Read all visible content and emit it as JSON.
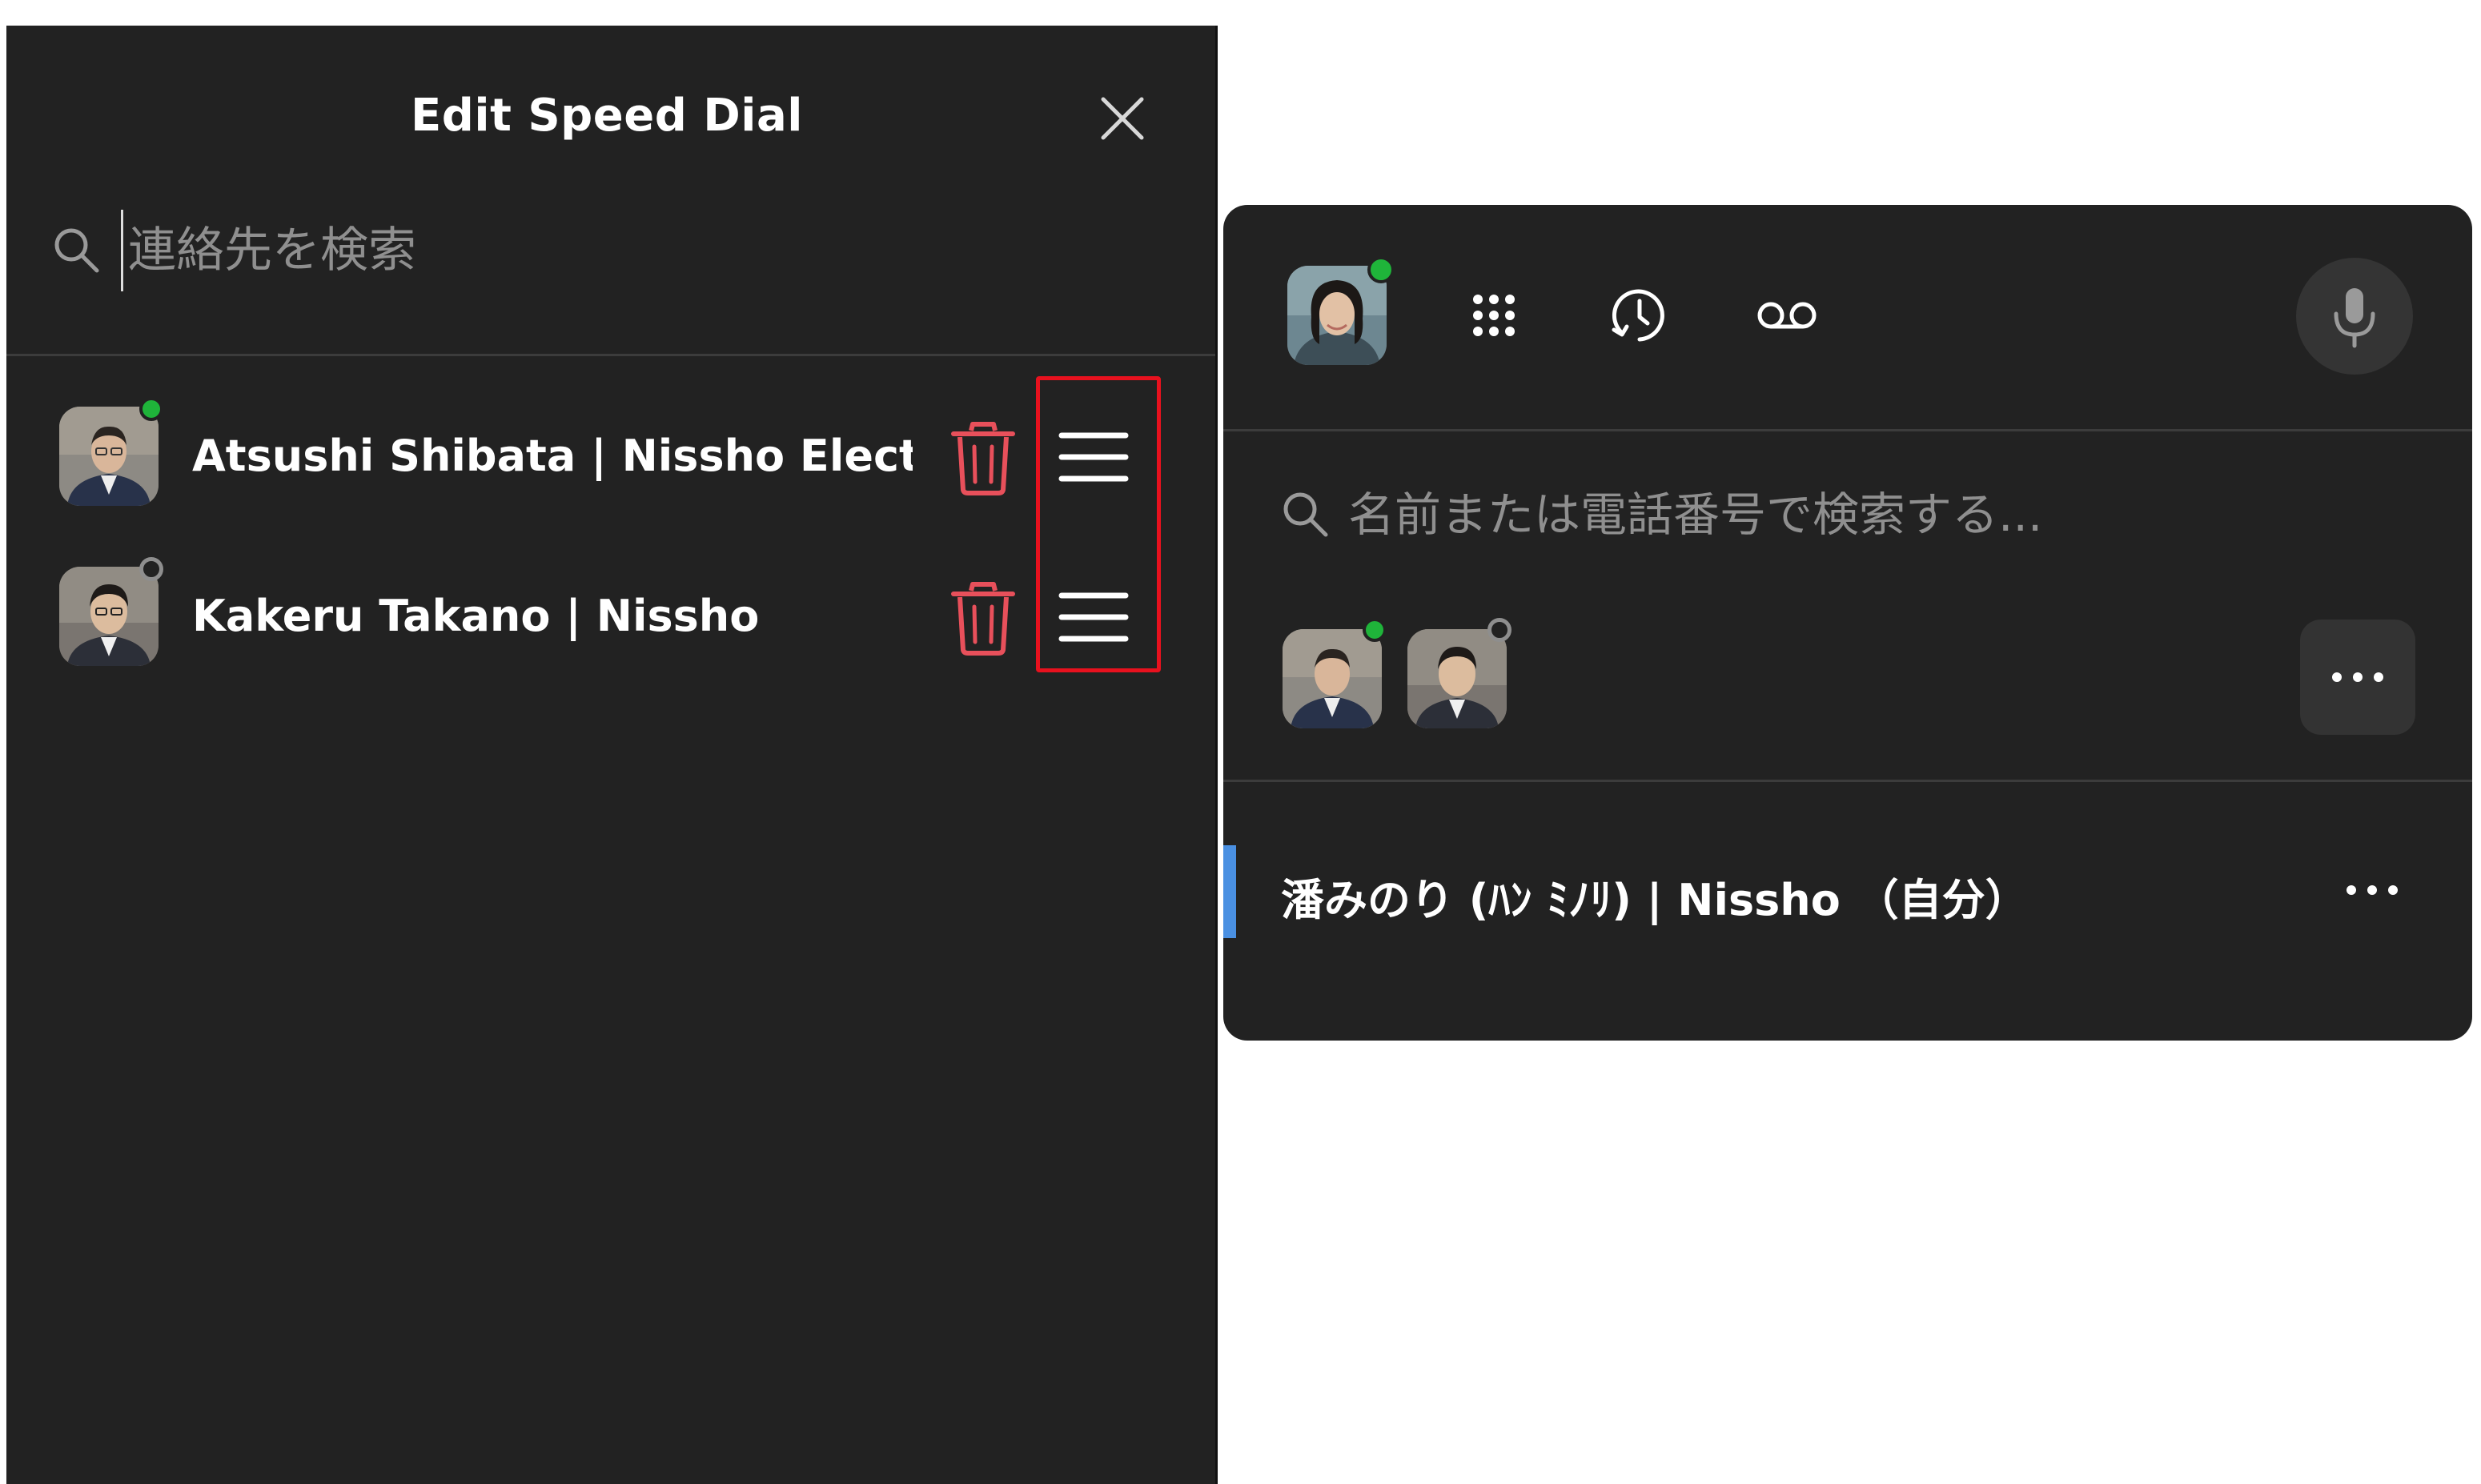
{
  "speed_dial": {
    "title": "Edit Speed Dial",
    "search_placeholder": "連絡先を検索",
    "entries": [
      {
        "name": "Atsushi Shibata | Nissho Elect...",
        "presence": "online"
      },
      {
        "name": "Kakeru Takano | Nissho",
        "presence": "offline"
      }
    ],
    "icons": {
      "close": "close-icon",
      "search": "search-icon",
      "delete": "trash-icon",
      "reorder": "drag-handle-icon"
    }
  },
  "phone_panel": {
    "my_presence": "online",
    "toolbar_icons": [
      "dialpad-icon",
      "call-history-icon",
      "voicemail-icon",
      "microphone-icon"
    ],
    "search_placeholder": "名前または電話番号で検索する...",
    "favorites": [
      {
        "presence": "online"
      },
      {
        "presence": "offline"
      }
    ],
    "self_line": "潘みのり (ﾊﾝ ﾐﾉﾘ) | Nissho （自分）"
  },
  "colors": {
    "panel_bg": "#222222",
    "divider": "#3c3c3c",
    "online": "#1fb43a",
    "delete_red": "#e8505b",
    "highlight_box": "#e8111e",
    "self_accent": "#4a90e2"
  }
}
